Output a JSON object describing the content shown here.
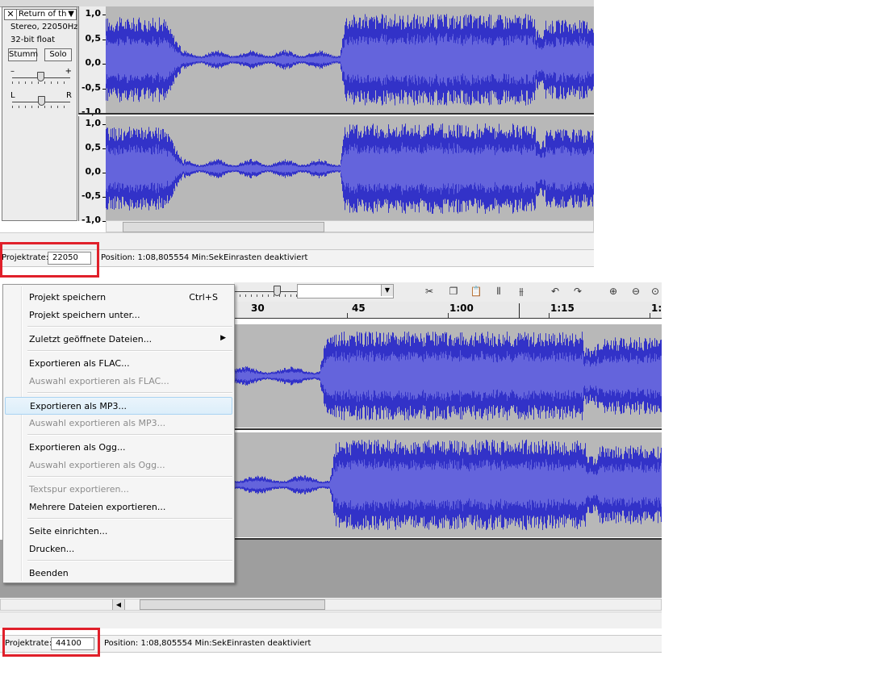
{
  "track": {
    "close_glyph": "✕",
    "name": "Return of th",
    "dropdown_glyph": "▼",
    "format": "Stereo, 22050Hz",
    "bit_depth": "32-bit float",
    "mute_label": "Stumm",
    "solo_label": "Solo",
    "gain_minus": "–",
    "gain_plus": "+",
    "pan_left": "L",
    "pan_right": "R",
    "gain_level": 0.48,
    "pan_level": 0.5
  },
  "amplitude_ticks": [
    "1,0",
    "0,5",
    "0,0",
    "-0,5",
    "-1,0"
  ],
  "top_status": {
    "rate_label": "Projektrate:",
    "rate_value": "22050",
    "position_text": "Position: 1:08,805554 Min:Sek",
    "snap_text": "Einrasten deaktiviert"
  },
  "bottom_status": {
    "rate_label": "Projektrate:",
    "rate_value": "44100",
    "position_text": "Position: 1:08,805554 Min:Sek",
    "snap_text": "Einrasten deaktiviert"
  },
  "timeline_labels": [
    "30",
    "45",
    "1:00",
    "1:15",
    "1:"
  ],
  "toolbar_icons": [
    "scissors-icon",
    "copy-icon",
    "paste-icon",
    "trim-icon",
    "silence-icon",
    "undo-icon",
    "redo-icon",
    "zoom-in-icon",
    "zoom-out-icon",
    "zoom-fit-icon"
  ],
  "scroll_left_glyph": "◀",
  "menu": {
    "submenu_arrow": "▶",
    "items": [
      {
        "label": "Projekt speichern",
        "accel": "Ctrl+S",
        "enabled": true
      },
      {
        "label": "Projekt speichern unter...",
        "accel": "",
        "enabled": true
      },
      {
        "label": "Zuletzt geöffnete Dateien...",
        "accel": "",
        "enabled": true,
        "submenu": true
      },
      {
        "label": "Exportieren als FLAC...",
        "accel": "",
        "enabled": true
      },
      {
        "label": "Auswahl exportieren als FLAC...",
        "accel": "",
        "enabled": false
      },
      {
        "label": "Exportieren als MP3...",
        "accel": "",
        "enabled": true,
        "highlighted": true
      },
      {
        "label": "Auswahl exportieren als MP3...",
        "accel": "",
        "enabled": false
      },
      {
        "label": "Exportieren als Ogg...",
        "accel": "",
        "enabled": true
      },
      {
        "label": "Auswahl exportieren als Ogg...",
        "accel": "",
        "enabled": false
      },
      {
        "label": "Textspur exportieren...",
        "accel": "",
        "enabled": false
      },
      {
        "label": "Mehrere Dateien exportieren...",
        "accel": "",
        "enabled": true
      },
      {
        "label": "Seite einrichten...",
        "accel": "",
        "enabled": true
      },
      {
        "label": "Drucken...",
        "accel": "",
        "enabled": true
      },
      {
        "label": "Beenden",
        "accel": "",
        "enabled": true
      }
    ]
  },
  "colors": {
    "wave_outer": "#3232c8",
    "wave_inner": "#6464dc",
    "wave_background": "#b8b8b8",
    "highlight_box": "#e0202a"
  }
}
